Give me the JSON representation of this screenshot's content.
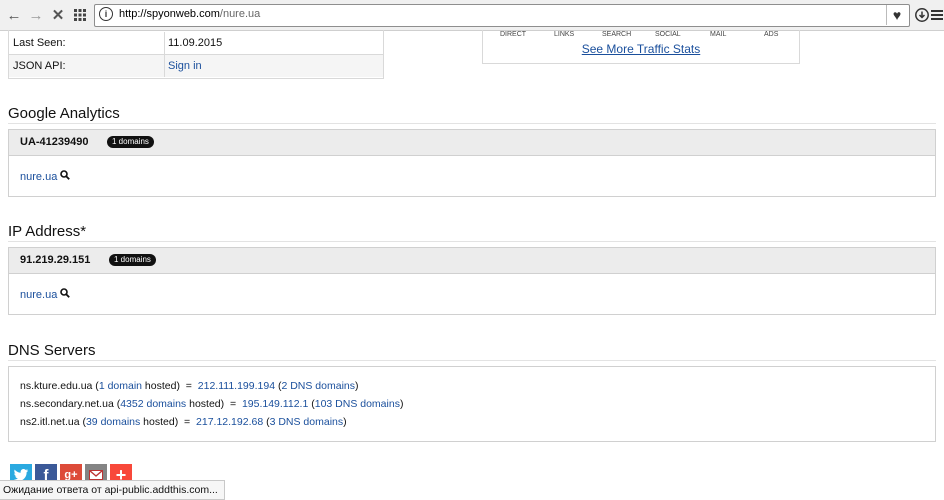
{
  "browser": {
    "url_host": "http://spyonweb.com",
    "url_path": "/nure.ua",
    "back_icon": "arrow-left-icon",
    "forward_icon": "arrow-right-icon",
    "stop_icon": "close-icon",
    "apps_icon": "grid-icon",
    "favorite_icon": "heart-icon",
    "download_icon": "download-icon",
    "menu_icon": "hamburger-icon"
  },
  "info": {
    "rows": [
      {
        "key": "Last Seen:",
        "value": "11.09.2015"
      },
      {
        "key": "JSON API:",
        "value": "Sign in"
      }
    ]
  },
  "traffic": {
    "labels": [
      "DIRECT",
      "LINKS",
      "SEARCH",
      "SOCIAL",
      "MAIL",
      "ADS"
    ],
    "link": "See More Traffic Stats"
  },
  "analytics": {
    "title": "Google Analytics",
    "code": "UA-41239490",
    "badge": "1 domains",
    "domain": "nure.ua"
  },
  "ip": {
    "title": "IP Address*",
    "address": "91.219.29.151",
    "badge": "1 domains",
    "domain": "nure.ua"
  },
  "dns": {
    "title": "DNS Servers",
    "servers": [
      {
        "name": "ns.kture.edu.ua",
        "open": " (",
        "count_link": "1 domain",
        "hosted": " hosted)  =  ",
        "ip": "212.111.199.194",
        "open2": " (",
        "dns_link": "2 DNS domains",
        "close": ")"
      },
      {
        "name": "ns.secondary.net.ua",
        "open": " (",
        "count_link": "4352 domains",
        "hosted": " hosted)  =  ",
        "ip": "195.149.112.1",
        "open2": " (",
        "dns_link": "103 DNS domains",
        "close": ")"
      },
      {
        "name": "ns2.itl.net.ua",
        "open": " (",
        "count_link": "39 domains",
        "hosted": " hosted)  =  ",
        "ip": "217.12.192.68",
        "open2": " (",
        "dns_link": "3 DNS domains",
        "close": ")"
      }
    ]
  },
  "share": [
    {
      "name": "twitter-icon",
      "color": "#2aa9e0",
      "glyph": "t"
    },
    {
      "name": "facebook-icon",
      "color": "#3b5998",
      "glyph": "f"
    },
    {
      "name": "google-plus-icon",
      "color": "#dd4b39",
      "glyph": "g+"
    },
    {
      "name": "email-icon",
      "color": "#848484",
      "glyph": "✉"
    },
    {
      "name": "addthis-icon",
      "color": "#f8483a",
      "glyph": "+"
    }
  ],
  "status": "Ожидание ответа от api-public.addthis.com..."
}
